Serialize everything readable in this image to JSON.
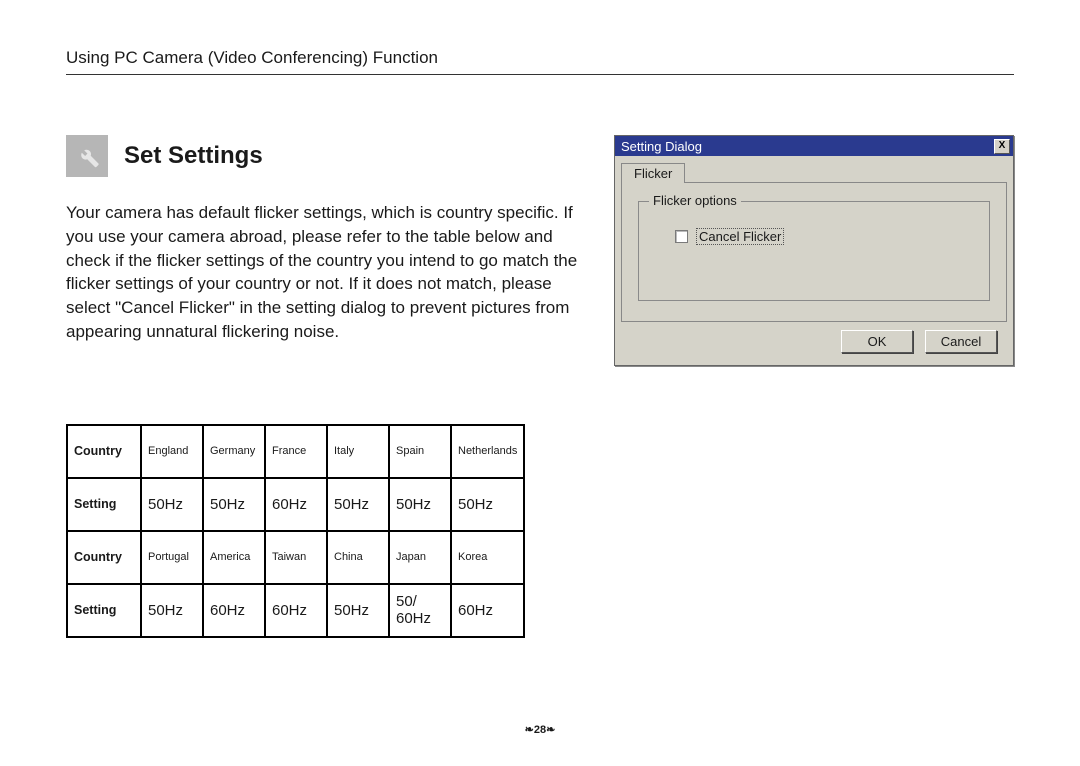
{
  "header": "Using PC Camera (Video Conferencing) Function",
  "section": {
    "icon_name": "wrench-icon",
    "title": "Set Settings",
    "body": "Your camera has default flicker settings, which is country specific. If you use your camera abroad, please refer to the table below and check if the flicker settings of the country you intend to go match the flicker settings of your country or not. If it does not match, please select \"Cancel Flicker\" in the setting dialog to prevent pictures from appearing unnatural flickering noise."
  },
  "table": {
    "row_labels": {
      "country": "Country",
      "setting": "Setting"
    },
    "rows": [
      {
        "countries": [
          "England",
          "Germany",
          "France",
          "Italy",
          "Spain",
          "Netherlands"
        ],
        "settings": [
          "50Hz",
          "50Hz",
          "60Hz",
          "50Hz",
          "50Hz",
          "50Hz"
        ]
      },
      {
        "countries": [
          "Portugal",
          "America",
          "Taiwan",
          "China",
          "Japan",
          "Korea"
        ],
        "settings": [
          "50Hz",
          "60Hz",
          "60Hz",
          "50Hz",
          "50/ 60Hz",
          "60Hz"
        ]
      }
    ]
  },
  "dialog": {
    "title": "Setting Dialog",
    "close_label": "X",
    "tab": "Flicker",
    "group_title": "Flicker options",
    "checkbox_label": "Cancel Flicker",
    "ok": "OK",
    "cancel": "Cancel"
  },
  "page_number": "❧28❧"
}
